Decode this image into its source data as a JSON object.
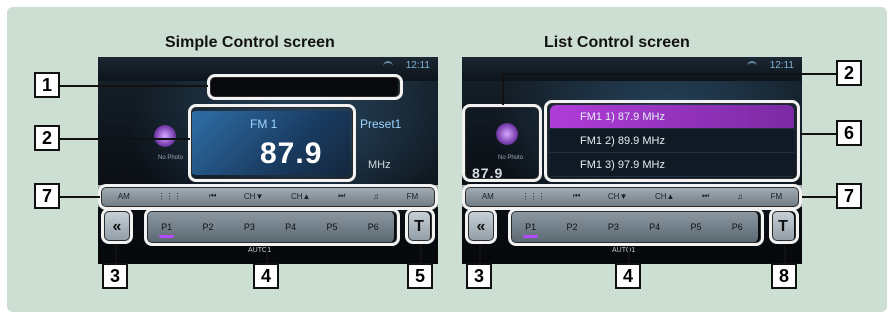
{
  "titles": {
    "left": "Simple Control screen",
    "right": "List Control screen"
  },
  "left_screen": {
    "clock": "12:11",
    "band": "FM 1",
    "preset": "Preset1",
    "frequency": "87.9",
    "unit": "MHz",
    "no_photo": "No Photo",
    "controls": [
      "AM",
      "⋮⋮⋮",
      "⏮",
      "CH▼",
      "CH▲",
      "⏭",
      "♫",
      "FM"
    ],
    "presets": [
      "P1",
      "P2",
      "P3",
      "P4",
      "P5",
      "P6"
    ],
    "auto": "AUTO1",
    "back": "«",
    "t_button": "T"
  },
  "right_screen": {
    "clock": "12:11",
    "no_photo": "No Photo",
    "partial_frequency": "87.9",
    "list": [
      "FM1 1) 87.9 MHz",
      "FM1 2) 89.9 MHz",
      "FM1 3) 97.9 MHz"
    ],
    "controls": [
      "AM",
      "⋮⋮⋮",
      "⏮",
      "CH▼",
      "CH▲",
      "⏭",
      "♫",
      "FM"
    ],
    "presets": [
      "P1",
      "P2",
      "P3",
      "P4",
      "P5",
      "P6"
    ],
    "auto": "AUTO1",
    "back": "«",
    "t_button": "T"
  },
  "callouts": {
    "c1": "1",
    "c2_left": "2",
    "c2_right": "2",
    "c3_left": "3",
    "c3_right": "3",
    "c4_left": "4",
    "c4_right": "4",
    "c5": "5",
    "c6": "6",
    "c7_left": "7",
    "c7_right": "7",
    "c8": "8"
  }
}
